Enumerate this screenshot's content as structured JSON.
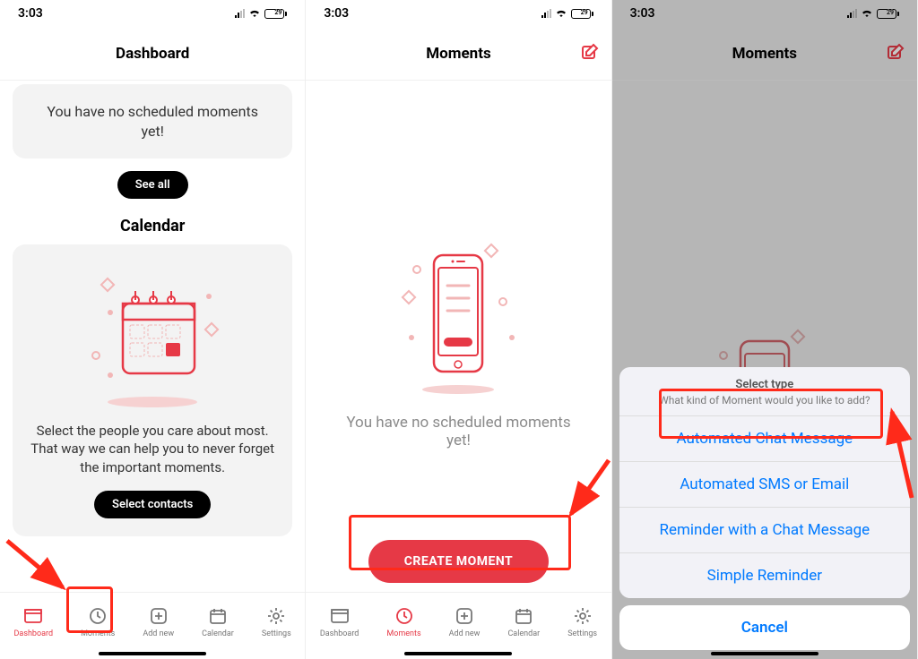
{
  "status": {
    "time": "3:03",
    "battery_pct": "29"
  },
  "tabs": {
    "dashboard": "Dashboard",
    "moments": "Moments",
    "addnew": "Add new",
    "calendar": "Calendar",
    "settings": "Settings"
  },
  "panel1": {
    "title": "Dashboard",
    "empty": "You have no scheduled moments yet!",
    "seeall": "See all",
    "calendar_title": "Calendar",
    "calendar_desc": "Select the people you care about most. That way we can help you to never forget the important moments.",
    "select_contacts": "Select contacts"
  },
  "panel2": {
    "title": "Moments",
    "empty": "You have no scheduled moments yet!",
    "create": "CREATE MOMENT"
  },
  "panel3": {
    "title": "Moments",
    "sheet_title": "Select type",
    "sheet_sub": "What kind of Moment would you like to add?",
    "opt1": "Automated Chat Message",
    "opt2": "Automated SMS or Email",
    "opt3": "Reminder with a Chat Message",
    "opt4": "Simple Reminder",
    "cancel": "Cancel"
  }
}
